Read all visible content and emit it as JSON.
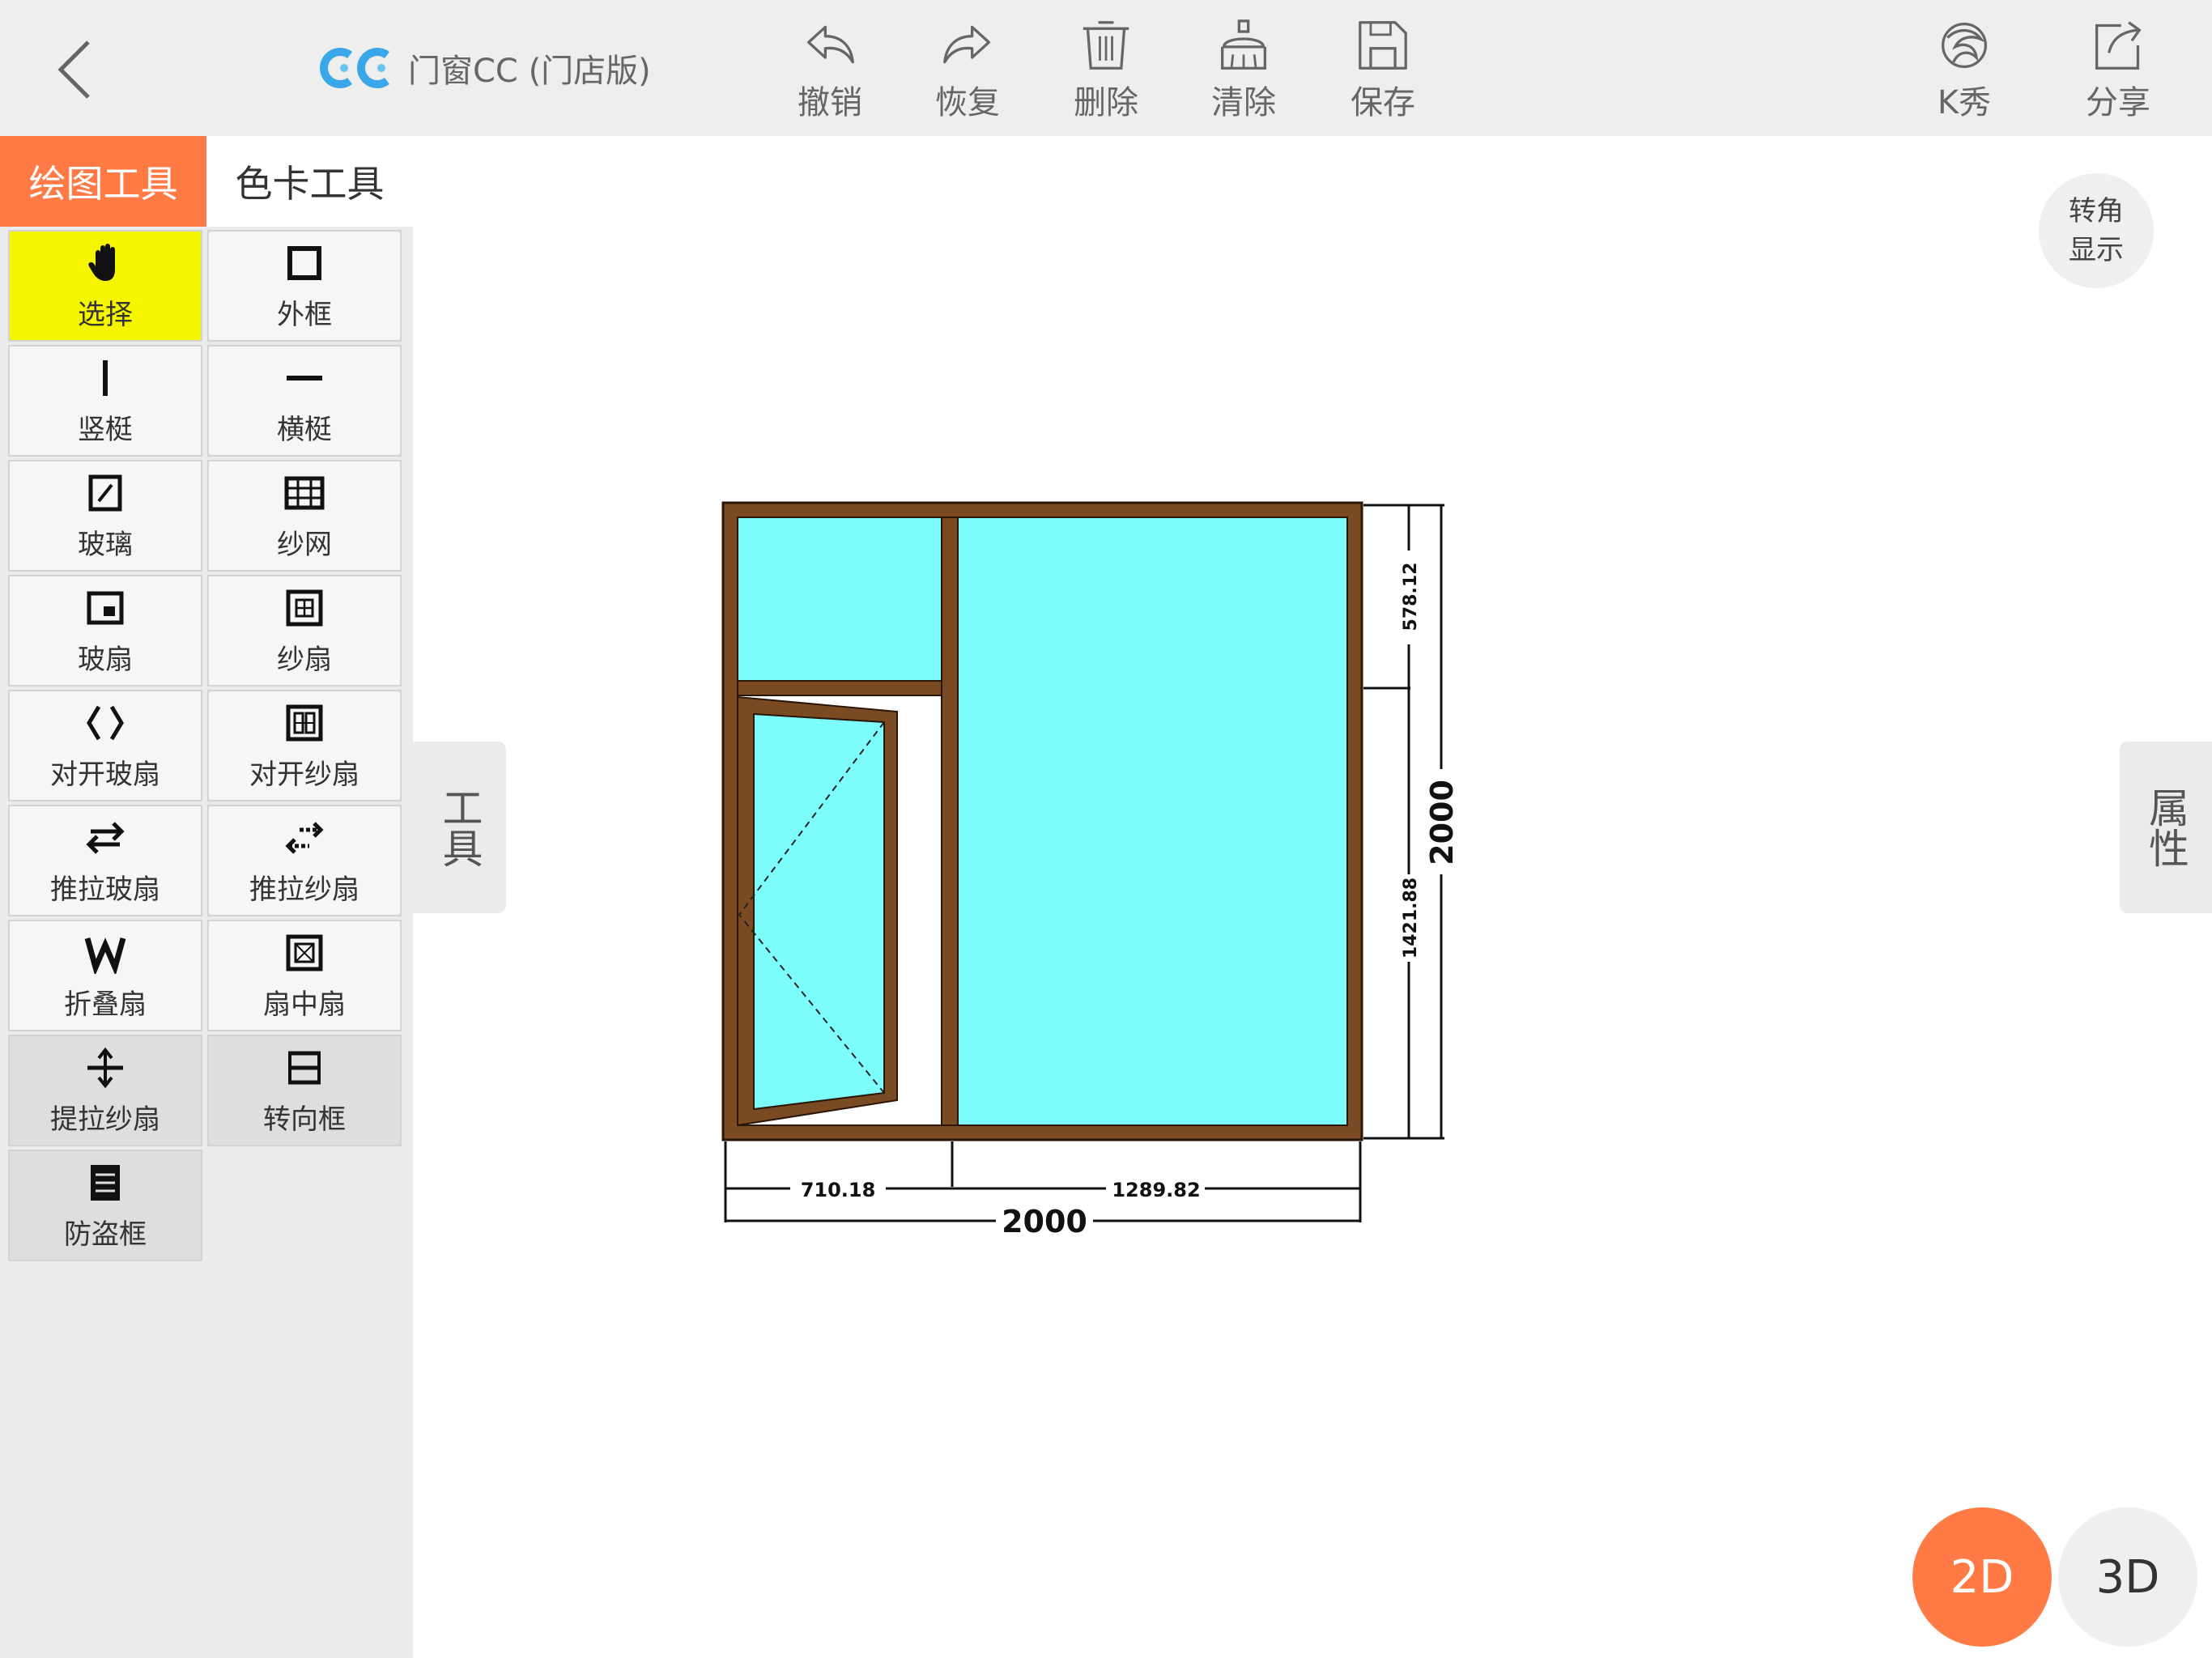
{
  "app": {
    "title": "门窗CC (门店版)"
  },
  "toolbar": {
    "undo": "撤销",
    "redo": "恢复",
    "delete": "删除",
    "clear": "清除",
    "save": "保存",
    "kshow": "K秀",
    "share": "分享"
  },
  "panel": {
    "tabs": [
      "绘图工具",
      "色卡工具"
    ],
    "tools": [
      {
        "label": "选择",
        "icon": "hand-icon"
      },
      {
        "label": "外框",
        "icon": "outer-frame-icon"
      },
      {
        "label": "竖梃",
        "icon": "vertical-mullion-icon"
      },
      {
        "label": "横梃",
        "icon": "horizontal-mullion-icon"
      },
      {
        "label": "玻璃",
        "icon": "glass-icon"
      },
      {
        "label": "纱网",
        "icon": "screen-mesh-icon"
      },
      {
        "label": "玻扇",
        "icon": "glass-sash-icon"
      },
      {
        "label": "纱扇",
        "icon": "screen-sash-icon"
      },
      {
        "label": "对开玻扇",
        "icon": "double-glass-sash-icon"
      },
      {
        "label": "对开纱扇",
        "icon": "double-screen-sash-icon"
      },
      {
        "label": "推拉玻扇",
        "icon": "sliding-glass-sash-icon"
      },
      {
        "label": "推拉纱扇",
        "icon": "sliding-screen-sash-icon"
      },
      {
        "label": "折叠扇",
        "icon": "folding-sash-icon"
      },
      {
        "label": "扇中扇",
        "icon": "sash-in-sash-icon"
      },
      {
        "label": "提拉纱扇",
        "icon": "lift-screen-sash-icon"
      },
      {
        "label": "转向框",
        "icon": "turning-frame-icon"
      },
      {
        "label": "防盗框",
        "icon": "security-frame-icon"
      }
    ]
  },
  "drawers": {
    "left": "工具",
    "right": "属性"
  },
  "canvas": {
    "corner_toggle": "转角显示",
    "dimensions": {
      "total_width": "2000",
      "total_height": "2000",
      "left_width": "710.18",
      "right_width": "1289.82",
      "top_height": "578.12",
      "bottom_height": "1421.88"
    },
    "colors": {
      "frame": "#7a4a22",
      "glass": "#7dfcfc",
      "accent": "#ff7a45",
      "selected": "#f5f500"
    }
  },
  "view": {
    "mode_2d": "2D",
    "mode_3d": "3D"
  }
}
